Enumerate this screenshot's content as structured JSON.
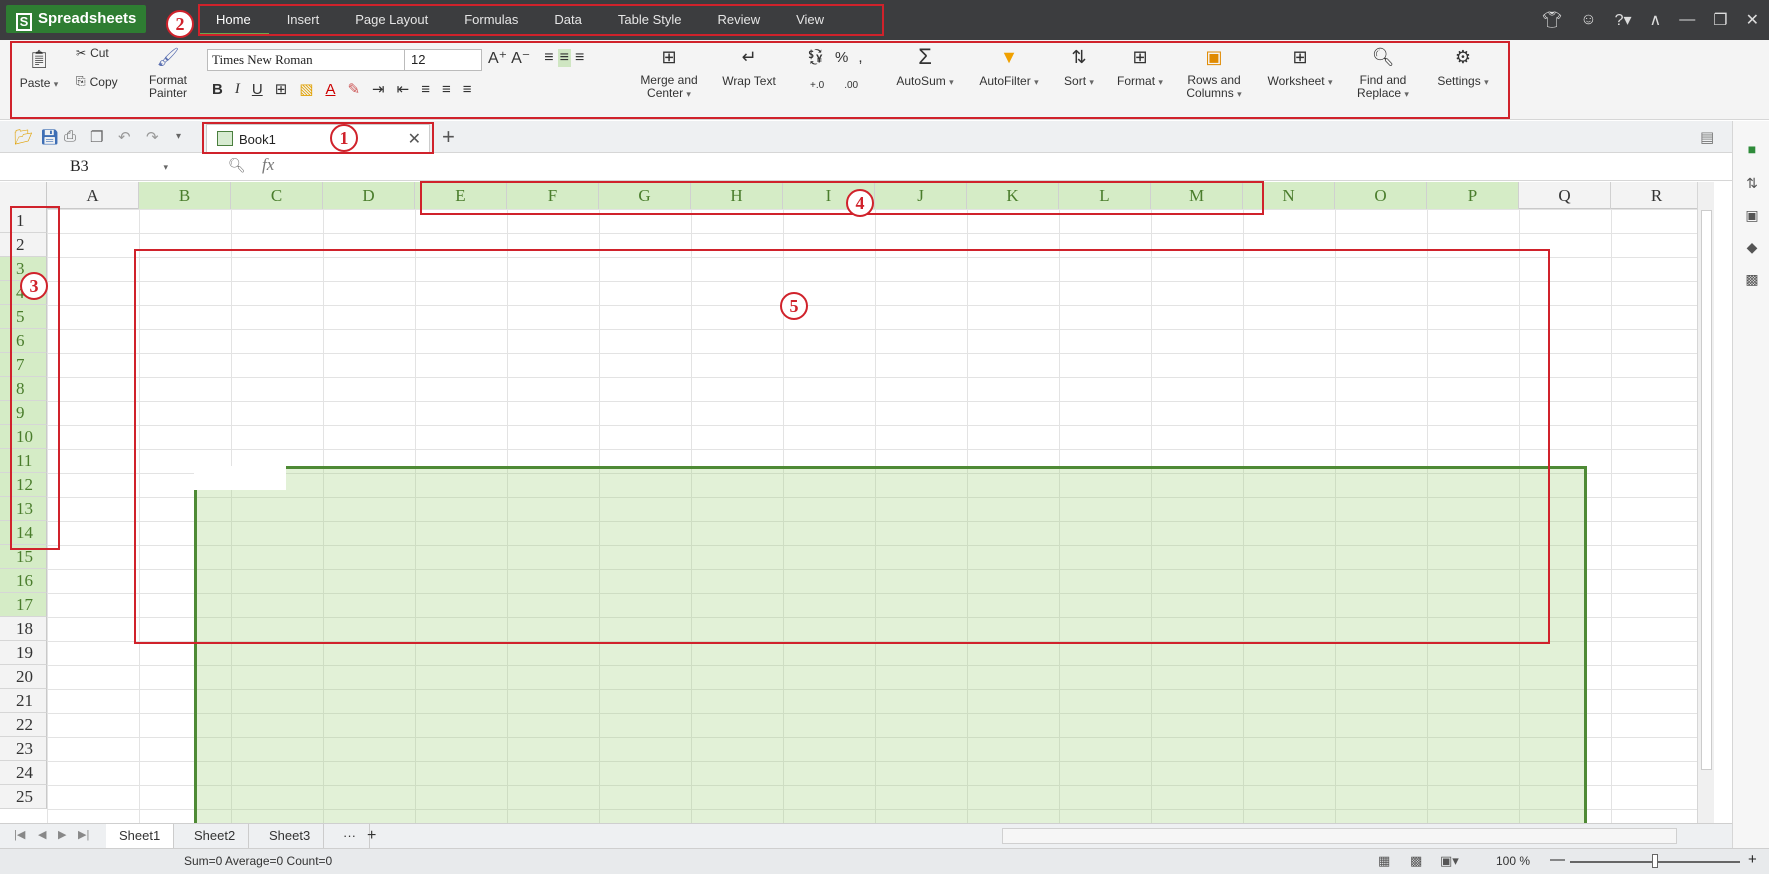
{
  "app": {
    "name": "Spreadsheets"
  },
  "menu": {
    "tabs": [
      "Home",
      "Insert",
      "Page Layout",
      "Formulas",
      "Data",
      "Table Style",
      "Review",
      "View"
    ],
    "active": "Home"
  },
  "ribbon": {
    "paste": "Paste",
    "cut": "Cut",
    "copy": "Copy",
    "format_painter_1": "Format",
    "format_painter_2": "Painter",
    "font_name": "Times New Roman",
    "font_size": "12",
    "merge_1": "Merge and",
    "merge_2": "Center",
    "wrap": "Wrap Text",
    "autosum": "AutoSum",
    "autofilter": "AutoFilter",
    "sort": "Sort",
    "format": "Format",
    "rows_cols_1": "Rows and",
    "rows_cols_2": "Columns",
    "worksheet": "Worksheet",
    "find_1": "Find and",
    "find_2": "Replace",
    "settings": "Settings"
  },
  "document": {
    "tab_name": "Book1"
  },
  "formula_bar": {
    "cell_ref": "B3",
    "fx": "fx"
  },
  "grid": {
    "columns": [
      "A",
      "B",
      "C",
      "D",
      "E",
      "F",
      "G",
      "H",
      "I",
      "J",
      "K",
      "L",
      "M",
      "N",
      "O",
      "P",
      "Q",
      "R"
    ],
    "rows": [
      "1",
      "2",
      "3",
      "4",
      "5",
      "6",
      "7",
      "8",
      "9",
      "10",
      "11",
      "12",
      "13",
      "14",
      "15",
      "16",
      "17",
      "18",
      "19",
      "20",
      "21",
      "22",
      "23",
      "24",
      "25"
    ],
    "selected_range": "B3:P17",
    "selection_color": "#d5ecc6"
  },
  "sheets": {
    "tabs": [
      "Sheet1",
      "Sheet2",
      "Sheet3"
    ],
    "active": "Sheet1",
    "more": "···",
    "add": "+"
  },
  "status": {
    "summary": "Sum=0  Average=0  Count=0",
    "zoom": "100 %"
  },
  "annotations": {
    "labels": [
      "1",
      "2",
      "3",
      "4",
      "5"
    ],
    "color": "#d0222b"
  }
}
